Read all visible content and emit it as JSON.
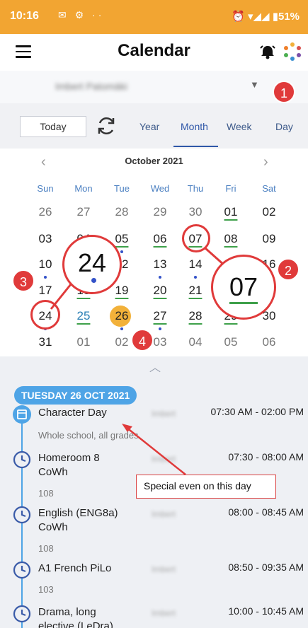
{
  "status": {
    "time": "10:16",
    "icons": "✉ ⚙ ··",
    "right": "⏰ ▾◢◢ ▮51%"
  },
  "app": {
    "title": "Calendar"
  },
  "user": {
    "name": "Imbert Patomäki"
  },
  "view": {
    "today": "Today",
    "tabs": [
      "Year",
      "Month",
      "Week",
      "Day"
    ],
    "active_tab": "Month"
  },
  "calendar": {
    "month": "October 2021",
    "weekdays": [
      "Sun",
      "Mon",
      "Tue",
      "Wed",
      "Thu",
      "Fri",
      "Sat"
    ],
    "weeks": [
      [
        "26",
        "27",
        "28",
        "29",
        "30",
        "01",
        "02"
      ],
      [
        "03",
        "04",
        "05",
        "06",
        "07",
        "08",
        "09"
      ],
      [
        "10",
        "11",
        "12",
        "13",
        "14",
        "15",
        "16"
      ],
      [
        "17",
        "18",
        "19",
        "20",
        "21",
        "22",
        "23"
      ],
      [
        "24",
        "25",
        "26",
        "27",
        "28",
        "29",
        "30"
      ],
      [
        "31",
        "01",
        "02",
        "03",
        "04",
        "05",
        "06"
      ]
    ],
    "selected_day": "26"
  },
  "zoom": {
    "left": "24",
    "right": "07"
  },
  "badges": [
    "1",
    "2",
    "3",
    "4"
  ],
  "agenda": {
    "date": "TUESDAY 26 OCT 2021",
    "events": [
      {
        "title": "Character Day",
        "sub": "Whole school, all grades",
        "time": "07:30 AM - 02:00 PM",
        "type": "calendar"
      },
      {
        "title": "Homeroom 8\nCoWh",
        "sub": "108",
        "time": "07:30 - 08:00 AM",
        "type": "clock"
      },
      {
        "title": "English (ENG8a)\nCoWh",
        "sub": "108",
        "time": "08:00 - 08:45 AM",
        "type": "clock"
      },
      {
        "title": "A1 French PiLo",
        "sub": "103",
        "time": "08:50 - 09:35 AM",
        "type": "clock"
      },
      {
        "title": "Drama, long\nelective (LeDra)",
        "sub": "",
        "time": "10:00 - 10:45 AM",
        "type": "clock"
      }
    ],
    "blurred_name": "Imbert"
  },
  "callout": {
    "text": "Special even on this day"
  },
  "colors": {
    "accent": "#f2a532",
    "annotation": "#e03a3a",
    "timeline": "#4ea4e6"
  }
}
